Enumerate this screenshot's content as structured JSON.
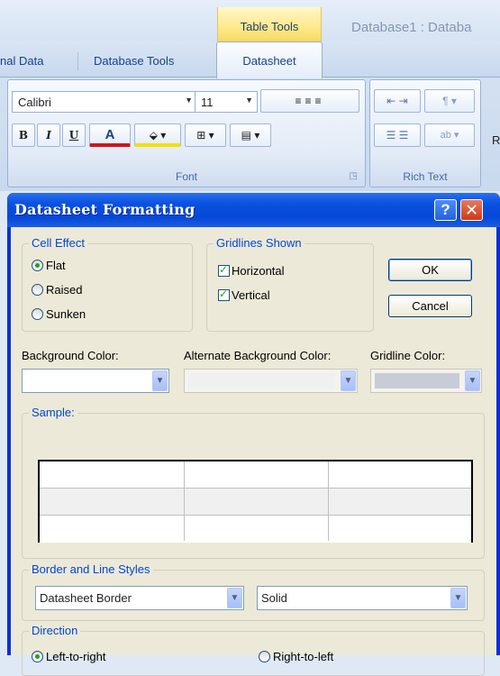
{
  "ribbon": {
    "context_tab": "Table Tools",
    "window_title": "Database1 : Databa",
    "tabs": [
      "nal Data",
      "Database Tools",
      "Datasheet"
    ],
    "font_group": {
      "font_name": "Calibri",
      "font_size": "11",
      "label": "Font",
      "bold": "B",
      "italic": "I",
      "underline": "U",
      "font_color": "A"
    },
    "rich_text_group": {
      "label": "Rich Text"
    },
    "partial_letter": "R"
  },
  "dialog": {
    "title": "Datasheet Formatting",
    "help": "?",
    "close": "✕",
    "cell_effect": {
      "legend": "Cell Effect",
      "options": [
        "Flat",
        "Raised",
        "Sunken"
      ],
      "selected": "Flat"
    },
    "gridlines": {
      "legend": "Gridlines Shown",
      "horizontal": "Horizontal",
      "vertical": "Vertical"
    },
    "ok": "OK",
    "cancel": "Cancel",
    "background_color_label": "Background Color:",
    "alternate_background_label": "Alternate Background Color:",
    "gridline_color_label": "Gridline Color:",
    "sample_legend": "Sample:",
    "border_legend": "Border and Line Styles",
    "border_select": "Datasheet Border",
    "line_style_select": "Solid",
    "direction_legend": "Direction",
    "direction_options": [
      "Left-to-right",
      "Right-to-left"
    ],
    "direction_selected": "Left-to-right",
    "colors": {
      "background": "#ffffff",
      "alternate": "#f0f0f0",
      "gridline": "#c0c0c0",
      "legend_text": "#0046d5",
      "title_bar": "#0548d8"
    }
  }
}
